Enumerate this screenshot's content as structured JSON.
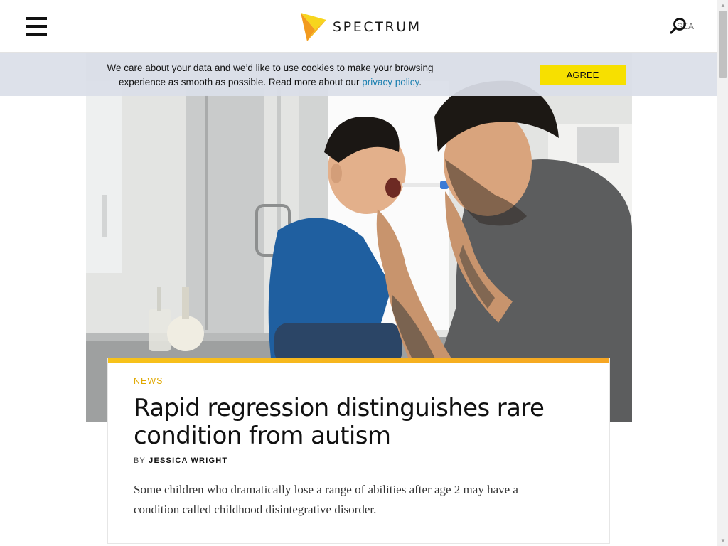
{
  "header": {
    "brand": "SPECTRUM",
    "search_placeholder": "SEA",
    "icons": {
      "menu": "hamburger-menu-icon",
      "logo": "spectrum-logo-mark",
      "search": "search-icon"
    },
    "colors": {
      "logo_yellow": "#f7c31a",
      "logo_orange": "#f29a1f"
    }
  },
  "cookie_banner": {
    "text_before": "We care about your data and we’d like to use cookies to make your browsing experience as smooth as possible. Read more about our ",
    "link_text": "privacy policy",
    "text_after": ".",
    "button_label": "AGREE",
    "colors": {
      "button": "#f7e000",
      "link": "#1a7fb0"
    }
  },
  "article": {
    "category": "NEWS",
    "title": "Rapid regression distinguishes rare condition from autism",
    "byline_prefix": "BY",
    "author": "JESSICA WRIGHT",
    "dek": "Some children who dramatically lose a range of abilities after age 2 may have a condition called childhood disintegrative disorder.",
    "accent_color": "#f6b21f"
  },
  "scrollbar": {
    "up": "▲",
    "down": "▼"
  }
}
